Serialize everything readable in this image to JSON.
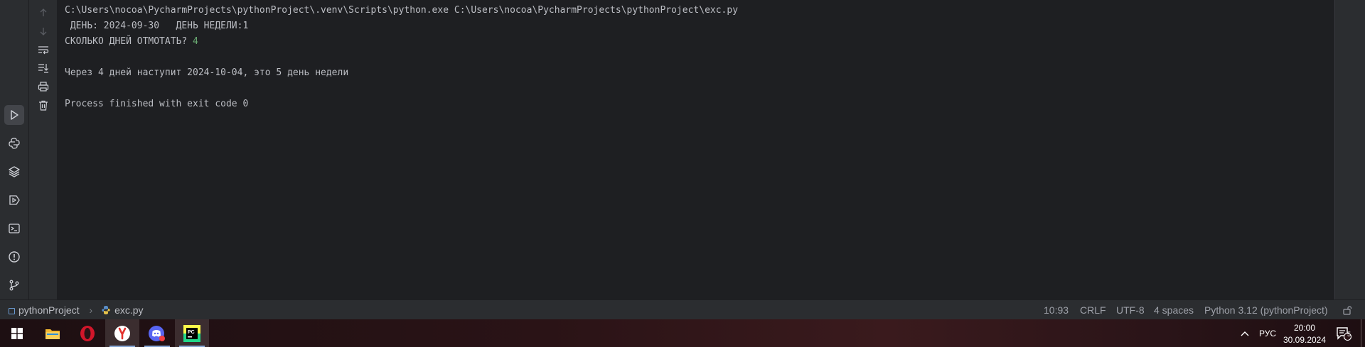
{
  "tool_window_bar": {
    "items": [
      {
        "name": "run",
        "icon": "run-icon"
      },
      {
        "name": "python-console",
        "icon": "python-icon"
      },
      {
        "name": "python-packages",
        "icon": "layers-icon"
      },
      {
        "name": "services",
        "icon": "services-icon"
      },
      {
        "name": "terminal",
        "icon": "terminal-icon"
      },
      {
        "name": "problems",
        "icon": "problems-icon"
      },
      {
        "name": "git",
        "icon": "git-icon"
      }
    ]
  },
  "console": {
    "lines": [
      "C:\\Users\\nocoa\\PycharmProjects\\pythonProject\\.venv\\Scripts\\python.exe C:\\Users\\nocoa\\PycharmProjects\\pythonProject\\exc.py",
      " ДЕНЬ: 2024-09-30   ДЕНЬ НЕДЕЛИ:1",
      "СКОЛЬКО ДНЕЙ ОТМОТАТЬ? ",
      "4",
      "",
      "Через 4 дней наступит 2024-10-04, это 5 день недели",
      "",
      "Process finished with exit code 0"
    ]
  },
  "status_bar": {
    "project": "pythonProject",
    "file": "exc.py",
    "position": "10:93",
    "line_separator": "CRLF",
    "encoding": "UTF-8",
    "indent": "4 spaces",
    "interpreter": "Python 3.12 (pythonProject)"
  },
  "taskbar": {
    "lang": "РУС",
    "time": "20:00",
    "date": "30.09.2024",
    "notification_count": "5"
  },
  "colors": {
    "console_bg": "#1e1f22",
    "panel_bg": "#2b2d30",
    "console_text": "#bcbec4",
    "user_input": "#6aab73"
  }
}
